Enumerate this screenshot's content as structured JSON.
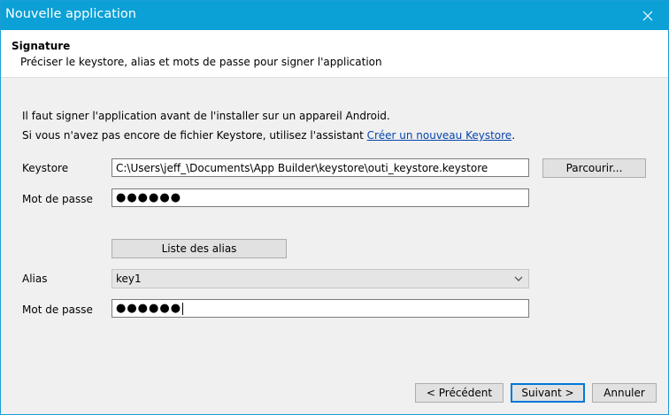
{
  "window": {
    "title": "Nouvelle application"
  },
  "header": {
    "title": "Signature",
    "subtitle": "Préciser le keystore, alias et mots de passe pour signer l'application"
  },
  "info": {
    "line1": "Il faut signer l'application avant de l'installer sur un appareil Android.",
    "line2_prefix": "Si vous n'avez pas encore de fichier Keystore, utilisez l'assistant ",
    "line2_link": "Créer un nouveau Keystore",
    "line2_suffix": "."
  },
  "keystore": {
    "label": "Keystore",
    "value": "C:\\Users\\jeff_\\Documents\\App Builder\\keystore\\outi_keystore.keystore",
    "browse_label": "Parcourir..."
  },
  "keystore_password": {
    "label": "Mot de passe",
    "value": "●●●●●●"
  },
  "alias_list_button": "Liste des alias",
  "alias": {
    "label": "Alias",
    "selected": "key1"
  },
  "alias_password": {
    "label": "Mot de passe",
    "value": "●●●●●●"
  },
  "footer": {
    "previous": "< Précédent",
    "next": "Suivant >",
    "cancel": "Annuler"
  },
  "icons": {
    "close": "close-icon",
    "dropdown": "chevron-down-icon"
  },
  "colors": {
    "titlebar": "#0ba0d6",
    "link": "#0645ad",
    "default_button_border": "#0078d7"
  }
}
